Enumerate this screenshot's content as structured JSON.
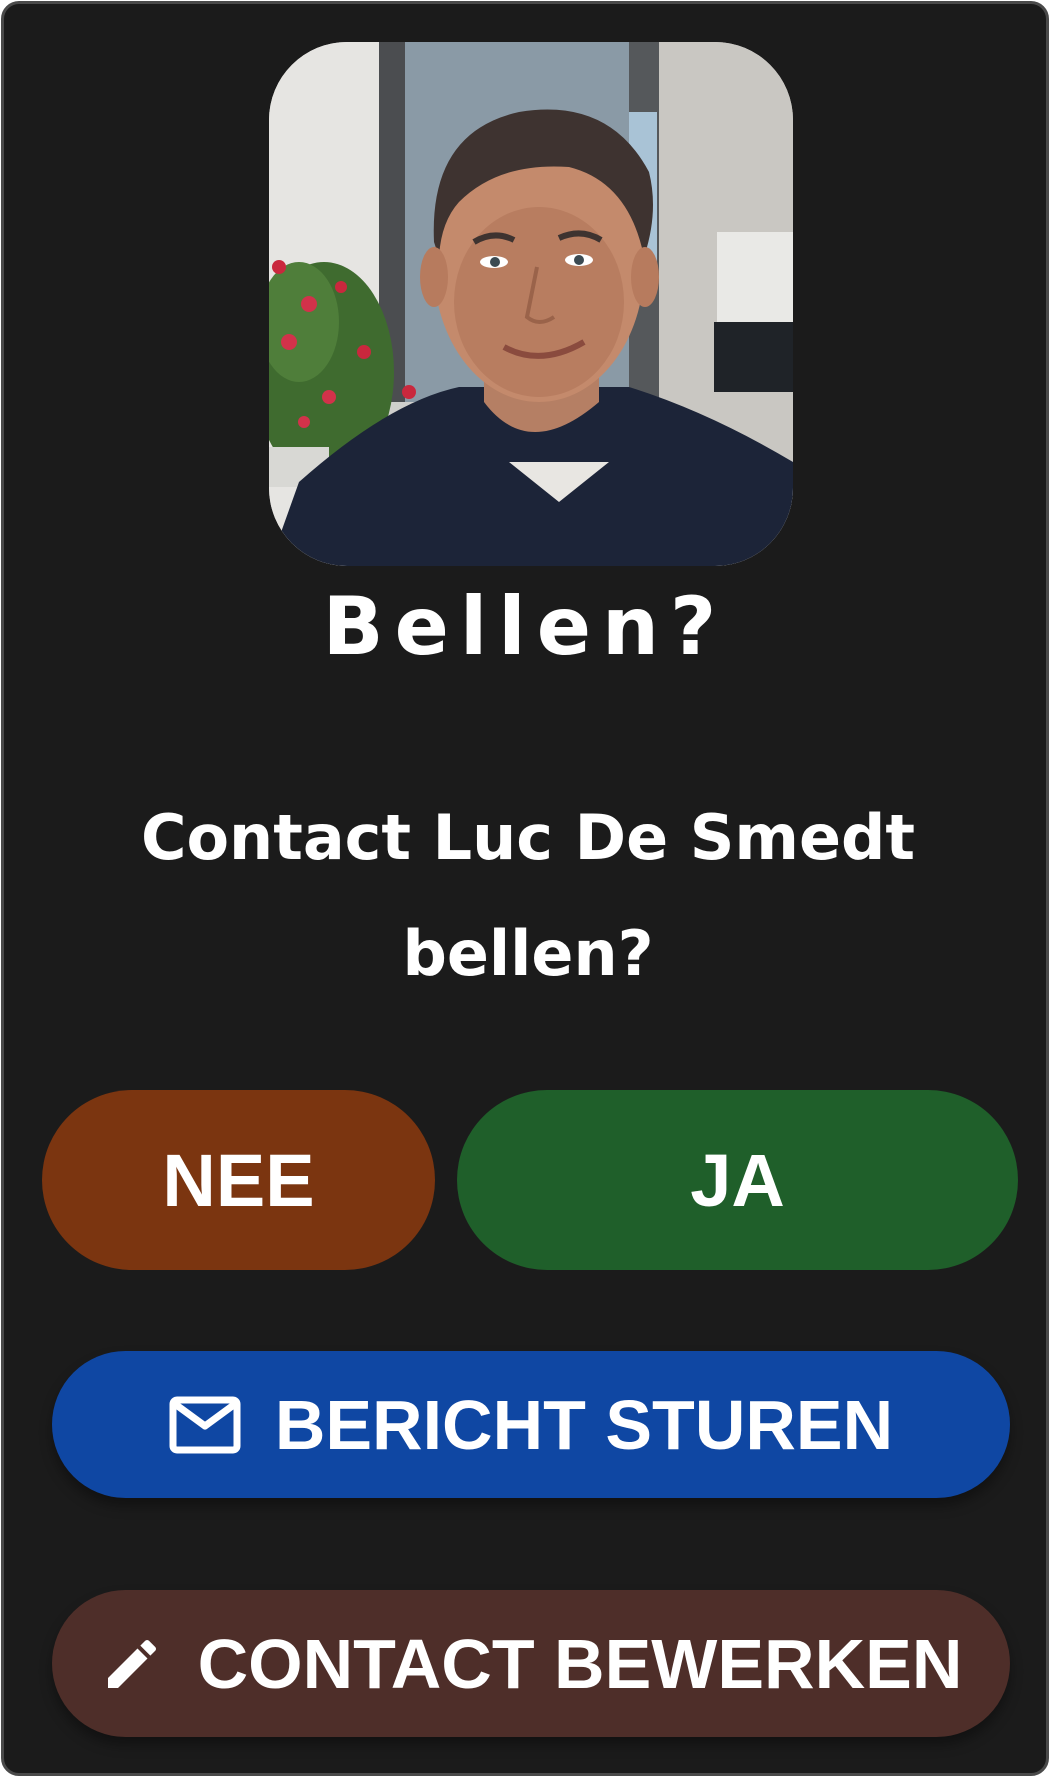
{
  "dialog": {
    "title": "Bellen?",
    "message": "Contact Luc De Smedt bellen?",
    "avatar_icon": "contact-photo",
    "buttons": {
      "no_label": "NEE",
      "yes_label": "JA",
      "message_label": "BERICHT STUREN",
      "message_icon": "mail-icon",
      "edit_label": "CONTACT BEWERKEN",
      "edit_icon": "pencil-icon"
    },
    "colors": {
      "background": "#1b1b1b",
      "no_button": "#7b3510",
      "yes_button": "#1f5f2a",
      "message_button": "#0f47a3",
      "edit_button": "#4e2e29",
      "text": "#ffffff"
    }
  }
}
